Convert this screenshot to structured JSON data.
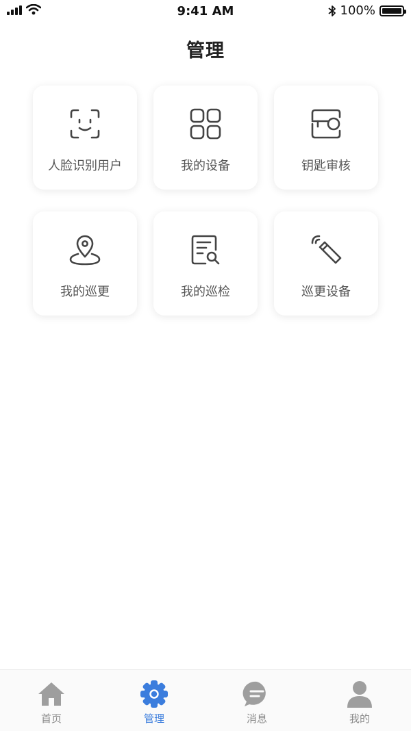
{
  "status_bar": {
    "time": "9:41 AM",
    "battery": "100%"
  },
  "header": {
    "title": "管理"
  },
  "grid": {
    "items": [
      {
        "label": "人脸识别用户",
        "icon": "face-scan-icon"
      },
      {
        "label": "我的设备",
        "icon": "grid-apps-icon"
      },
      {
        "label": "钥匙审核",
        "icon": "key-card-icon"
      },
      {
        "label": "我的巡更",
        "icon": "location-pin-icon"
      },
      {
        "label": "我的巡检",
        "icon": "document-search-icon"
      },
      {
        "label": "巡更设备",
        "icon": "wireless-tag-icon"
      }
    ]
  },
  "tab_bar": {
    "tabs": [
      {
        "label": "首页",
        "icon": "home-icon"
      },
      {
        "label": "管理",
        "icon": "gear-icon",
        "active": true
      },
      {
        "label": "消息",
        "icon": "message-icon"
      },
      {
        "label": "我的",
        "icon": "user-icon"
      }
    ]
  },
  "colors": {
    "accent": "#3b7ddd",
    "inactive": "#9e9e9e",
    "icon_stroke": "#444444"
  }
}
